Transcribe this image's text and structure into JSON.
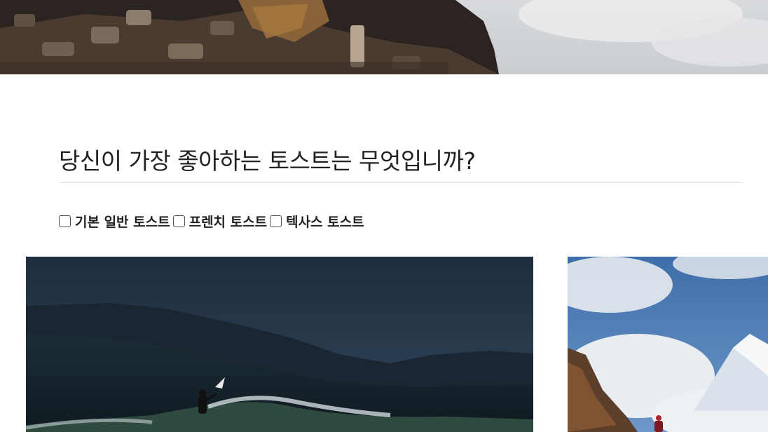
{
  "question": {
    "title": "당신이 가장 좋아하는 토스트는 무엇입니까?"
  },
  "options": [
    {
      "label": "기본 일반 토스트",
      "checked": false
    },
    {
      "label": "프렌치 토스트",
      "checked": false
    },
    {
      "label": "텍사스 토스트",
      "checked": false
    }
  ],
  "colors": {
    "text": "#222222",
    "divider": "#e4e4e4",
    "background": "#ffffff"
  }
}
